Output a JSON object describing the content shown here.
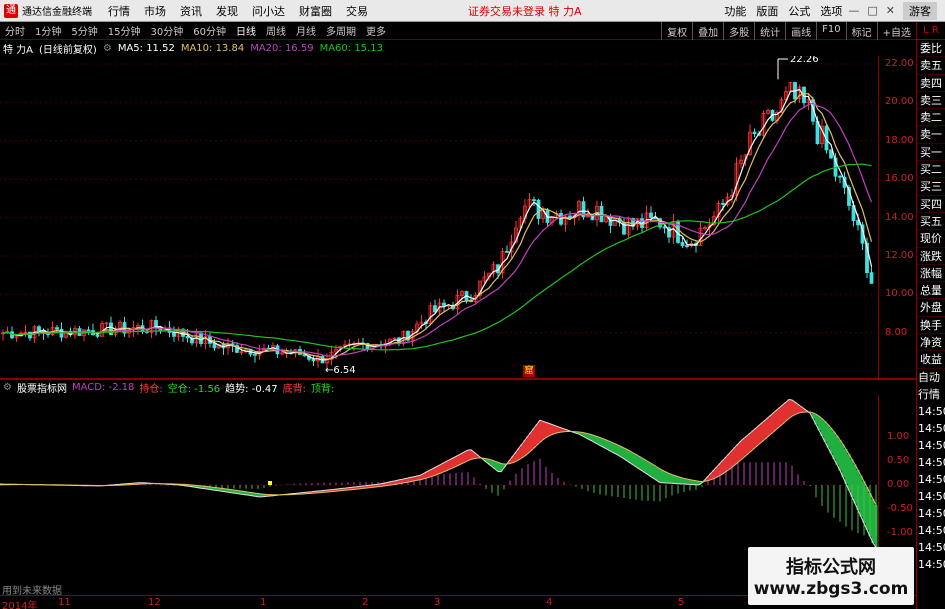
{
  "titlebar": {
    "app": "通达信金融终端",
    "menu": [
      "行情",
      "市场",
      "资讯",
      "发现",
      "问小达",
      "财富圈",
      "交易"
    ],
    "alert": "证券交易未登录",
    "stock": "特 力A",
    "right": [
      "功能",
      "版面",
      "公式",
      "选项"
    ],
    "guest": "游客"
  },
  "periods": [
    "分时",
    "1分钟",
    "5分钟",
    "15分钟",
    "30分钟",
    "60分钟",
    "日线",
    "周线",
    "月线",
    "多周期",
    "更多"
  ],
  "active_period": "日线",
  "toolbar_right": [
    "复权",
    "叠加",
    "多股",
    "统计",
    "画线",
    "F10",
    "标记",
    "+自选"
  ],
  "info": {
    "name": "特 力A",
    "mode": "(日线前复权)",
    "ma5": "MA5: 11.52",
    "ma10": "MA10: 13.84",
    "ma20": "MA20: 16.59",
    "ma60": "MA60: 15.13"
  },
  "colors": {
    "ma5": "#ffffff",
    "ma10": "#e0c060",
    "ma20": "#c040c0",
    "ma60": "#20c020",
    "up": "#ff3030",
    "down": "#40e0e0"
  },
  "price_axis": [
    "22.00",
    "20.00",
    "18.00",
    "16.00",
    "14.00",
    "12.00",
    "10.00",
    "8.00"
  ],
  "high_label": "22.26",
  "low_label": "6.54",
  "sidebar": {
    "top": "L R",
    "items": [
      "委比",
      "卖五",
      "卖四",
      "卖三",
      "卖二",
      "卖一",
      "买一",
      "买二",
      "买三",
      "买四",
      "买五",
      "现价",
      "涨跌",
      "涨幅",
      "总量",
      "外盘",
      "换手",
      "净资",
      "收益"
    ],
    "bottom": [
      "自动",
      "行情",
      "14:50",
      "14:50",
      "14:50",
      "14:50",
      "14:50",
      "14:50",
      "14:50",
      "14:50",
      "14:50",
      "14:50"
    ]
  },
  "macd": {
    "label": "股票指标网",
    "macd": "MACD: -2.18",
    "chicang": "持仓:",
    "kongcang": "空仓: -1.56",
    "qushi": "趋势: -0.47",
    "diding": "底背:",
    "dingbei": "顶背:"
  },
  "macd_axis": [
    "1.00",
    "0.50",
    "0.00",
    "-0.50",
    "-1.00"
  ],
  "dates": [
    "2014年",
    "11",
    "12",
    "1",
    "2",
    "3",
    "4",
    "5"
  ],
  "watermark": {
    "line1": "指标公式网",
    "line2": "www.zbgs3.com"
  },
  "future": "用到未来数据",
  "xmark": "窟"
}
